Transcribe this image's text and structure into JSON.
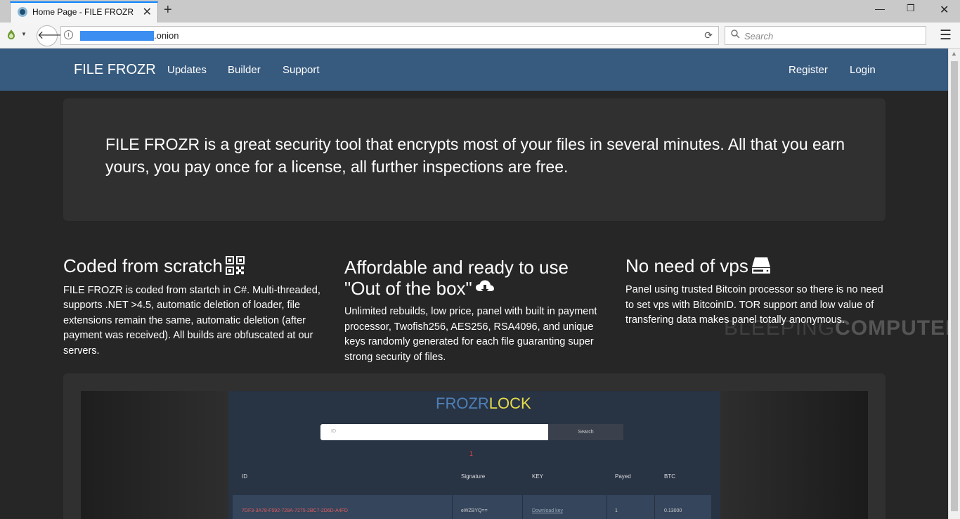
{
  "browser": {
    "tab_title": "Home Page - FILE FROZR",
    "tab_close": "✕",
    "new_tab": "+",
    "url_suffix": ".onion",
    "search_placeholder": "Search",
    "win_min": "—",
    "win_max": "❐",
    "win_close": "✕",
    "menu_glyph": "☰",
    "accent": "#0a84ff"
  },
  "site": {
    "brand": "FILE FROZR",
    "nav_left": [
      "Updates",
      "Builder",
      "Support"
    ],
    "nav_right": [
      "Register",
      "Login"
    ],
    "nav_color": "#375a7f",
    "jumbotron": "FILE FROZR is a great security tool that encrypts most of your files in several minutes. All that you earn yours, you pay once for a license, all further inspections are free.",
    "features": [
      {
        "title": "Coded from scratch",
        "icon": "qrcode-icon",
        "text": "FILE FROZR is coded from startch in C#. Multi-threaded, supports .NET >4.5, automatic deletion of loader, file extensions remain the same, automatic deletion (after payment was received). All builds are obfuscated at our servers."
      },
      {
        "title_line1": "Affordable and ready to use",
        "title_line2": "\"Out of the box\"",
        "icon": "cloud-download-icon",
        "text": "Unlimited rebuilds, low price, panel with built in payment processor, Twofish256, AES256, RSA4096, and unique keys randomly generated for each file guaranting super strong security of files."
      },
      {
        "title": "No need of vps",
        "icon": "hdd-icon",
        "text": "Panel using trusted Bitcoin processor so there is no need to set vps with BitcoinID. TOR support and low value of transfering data makes panel totally anonymous."
      }
    ],
    "watermark_light": "BLEEPING",
    "watermark_bold": "COMPUTER"
  },
  "panel": {
    "logo_part1": "FROZR",
    "logo_part2": "LOCK",
    "input_placeholder": "ID",
    "search_button": "Search",
    "page_number": "1",
    "columns": [
      "ID",
      "Signature",
      "KEY",
      "Payed",
      "BTC"
    ],
    "rows": [
      {
        "id": "7DF3-3A78-F592-728A-7275-2BC7-2D6D-A4FD",
        "signature": "eWZBYQ==",
        "key": "Download key",
        "payed": "1",
        "btc": "0.13000"
      }
    ]
  }
}
